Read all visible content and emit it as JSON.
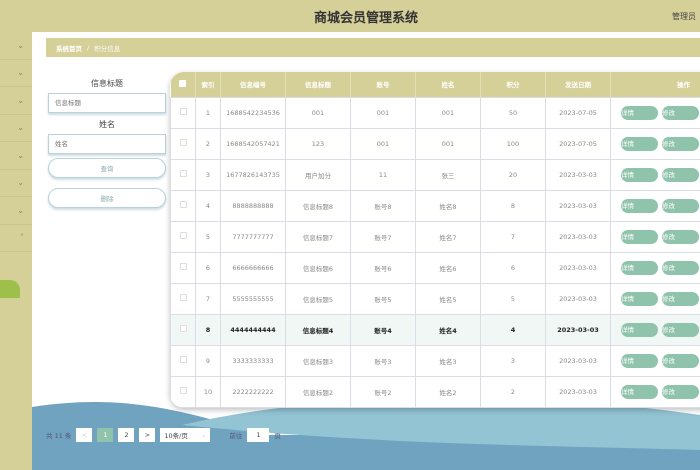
{
  "header": {
    "title": "商城会员管理系统",
    "user": "管理员"
  },
  "breadcrumb": {
    "home": "系统首页",
    "current": "积分信息"
  },
  "sidebar": {
    "items": 8
  },
  "search": {
    "title_label": "信息标题",
    "title_placeholder": "信息标题",
    "name_label": "姓名",
    "name_placeholder": "姓名",
    "query_button": "查询",
    "delete_button": "删除"
  },
  "table": {
    "columns": [
      "",
      "索引",
      "信息编号",
      "信息标题",
      "账号",
      "姓名",
      "积分",
      "发送日期",
      "操作"
    ],
    "detail_label": "详情",
    "edit_label": "修改",
    "rows": [
      [
        "1",
        "1688542234536",
        "001",
        "001",
        "001",
        "50",
        "2023-07-05"
      ],
      [
        "2",
        "1688542057421",
        "123",
        "001",
        "001",
        "100",
        "2023-07-05"
      ],
      [
        "3",
        "1677826143735",
        "用户加分",
        "11",
        "张三",
        "20",
        "2023-03-03"
      ],
      [
        "4",
        "8888888888",
        "信息标题8",
        "账号8",
        "姓名8",
        "8",
        "2023-03-03"
      ],
      [
        "5",
        "7777777777",
        "信息标题7",
        "账号7",
        "姓名7",
        "7",
        "2023-03-03"
      ],
      [
        "6",
        "6666666666",
        "信息标题6",
        "账号6",
        "姓名6",
        "6",
        "2023-03-03"
      ],
      [
        "7",
        "5555555555",
        "信息标题5",
        "账号5",
        "姓名5",
        "5",
        "2023-03-03"
      ],
      [
        "8",
        "4444444444",
        "信息标题4",
        "账号4",
        "姓名4",
        "4",
        "2023-03-03"
      ],
      [
        "9",
        "3333333333",
        "信息标题3",
        "账号3",
        "姓名3",
        "3",
        "2023-03-03"
      ],
      [
        "10",
        "2222222222",
        "信息标题2",
        "账号2",
        "姓名2",
        "2",
        "2023-03-03"
      ]
    ],
    "highlighted_row": 8
  },
  "pagination": {
    "total": "共 11 条",
    "prev": "<",
    "pages": [
      "1",
      "2"
    ],
    "current": "1",
    "next": ">",
    "page_size": "10条/页",
    "goto_label": "前往",
    "goto_value": "1",
    "goto_suffix": "页"
  },
  "colors": {
    "primary": "#d5cf98",
    "button": "#8fc3ab",
    "wave": "#6fa3c0"
  }
}
